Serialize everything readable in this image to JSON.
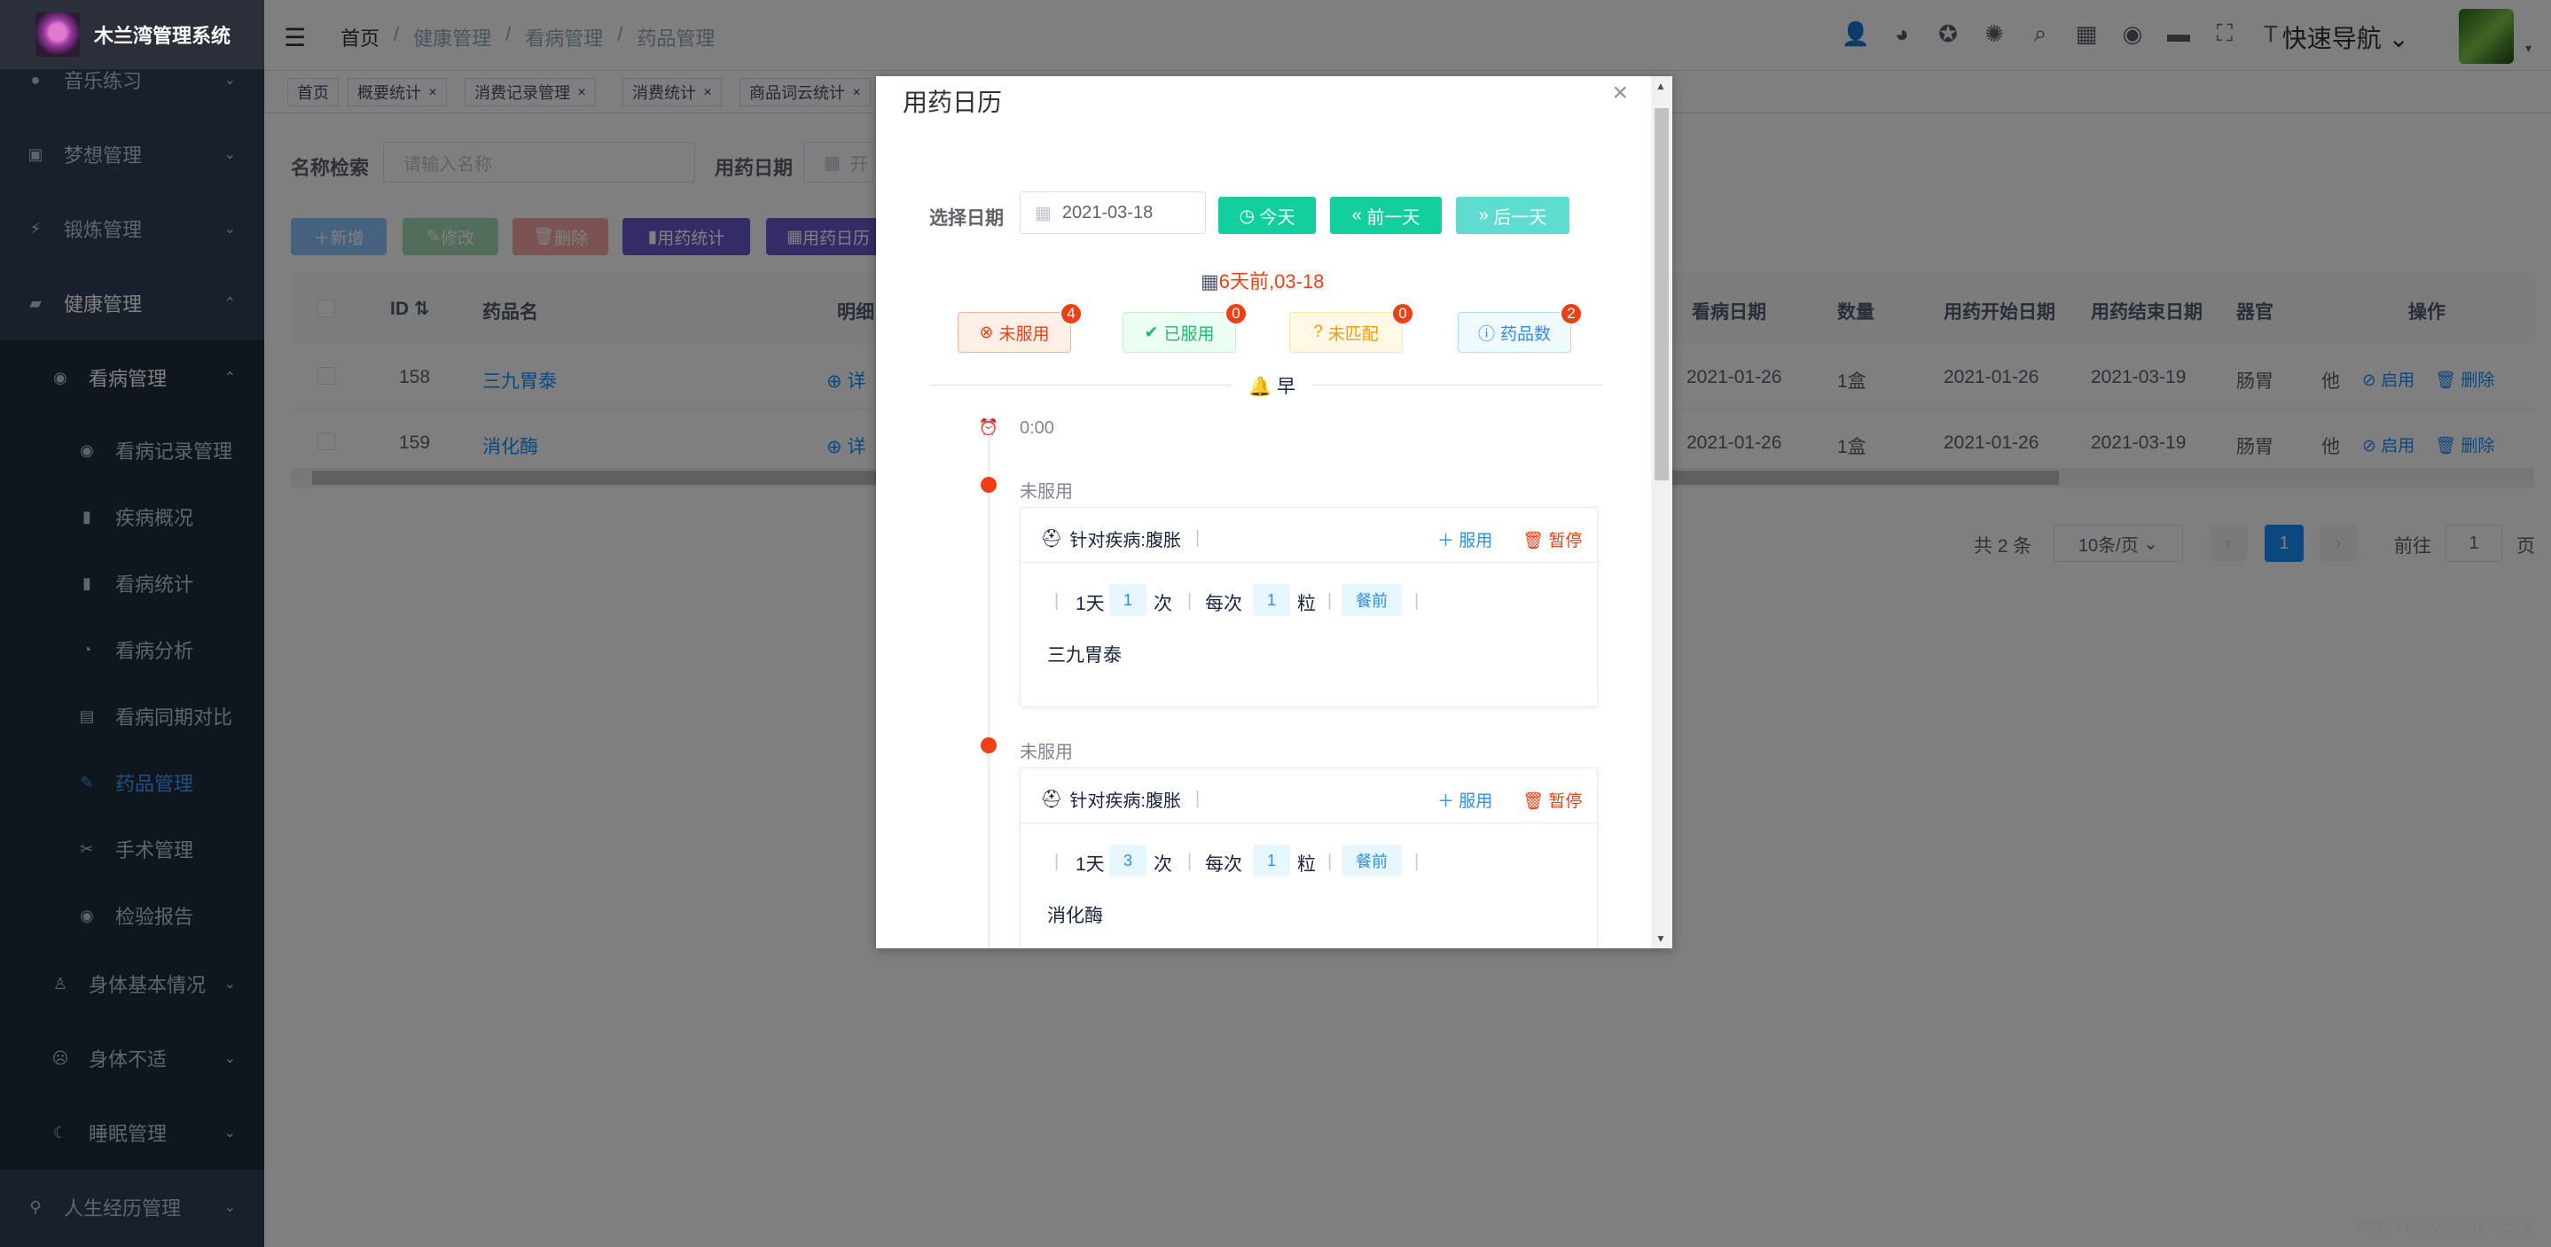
{
  "app": {
    "title": "木兰湾管理系统"
  },
  "sidebar": {
    "items": [
      {
        "label": "音乐练习",
        "icon": "music-icon"
      },
      {
        "label": "梦想管理",
        "icon": "dream-icon"
      },
      {
        "label": "锻炼管理",
        "icon": "exercise-icon"
      },
      {
        "label": "健康管理",
        "icon": "health-icon"
      },
      {
        "label": "看病管理",
        "icon": "hospital-icon"
      },
      {
        "label": "看病记录管理",
        "icon": "record-icon"
      },
      {
        "label": "疾病概况",
        "icon": "bar-chart-icon"
      },
      {
        "label": "看病统计",
        "icon": "bar-chart-icon"
      },
      {
        "label": "看病分析",
        "icon": "pie-chart-icon"
      },
      {
        "label": "看病同期对比",
        "icon": "compare-icon"
      },
      {
        "label": "药品管理",
        "icon": "medicine-icon"
      },
      {
        "label": "手术管理",
        "icon": "surgery-icon"
      },
      {
        "label": "检验报告",
        "icon": "report-icon"
      },
      {
        "label": "身体基本情况",
        "icon": "body-icon"
      },
      {
        "label": "身体不适",
        "icon": "discomfort-icon"
      },
      {
        "label": "睡眠管理",
        "icon": "moon-icon"
      },
      {
        "label": "人生经历管理",
        "icon": "life-icon"
      }
    ]
  },
  "header": {
    "breadcrumb": [
      "首页",
      "健康管理",
      "看病管理",
      "药品管理"
    ],
    "quick_nav": "快速导航"
  },
  "tags": [
    {
      "label": "首页"
    },
    {
      "label": "概要统计"
    },
    {
      "label": "消费记录管理"
    },
    {
      "label": "消费统计"
    },
    {
      "label": "商品词云统计"
    }
  ],
  "search": {
    "name_label": "名称检索",
    "name_placeholder": "请输入名称",
    "date_label": "用药日期",
    "date_placeholder": "开"
  },
  "toolbar": {
    "add": "新增",
    "edit": "修改",
    "delete": "删除",
    "stats": "用药统计",
    "calendar": "用药日历"
  },
  "table": {
    "headers": {
      "id": "ID",
      "name": "药品名",
      "detail": "明细",
      "disease_date": "看病日期",
      "qty": "数量",
      "start": "用药开始日期",
      "end": "用药结束日期",
      "organ": "器官",
      "ops": "操作"
    },
    "rows": [
      {
        "id": "158",
        "name": "三九胃泰",
        "detail": "详",
        "disease_date": "2021-01-26",
        "qty": "1盒",
        "start": "2021-01-26",
        "end": "2021-03-19",
        "organ": "肠胃",
        "extra": "他",
        "enable": "启用",
        "del": "删除"
      },
      {
        "id": "159",
        "name": "消化酶",
        "detail": "详",
        "disease_date": "2021-01-26",
        "qty": "1盒",
        "start": "2021-01-26",
        "end": "2021-03-19",
        "organ": "肠胃",
        "extra": "他",
        "enable": "启用",
        "del": "删除"
      }
    ]
  },
  "pagination": {
    "total": "共 2 条",
    "page_size": "10条/页",
    "current": "1",
    "goto_label": "前往",
    "goto_value": "1",
    "page_suffix": "页"
  },
  "dialog": {
    "title": "用药日历",
    "date_label": "选择日期",
    "date_value": "2021-03-18",
    "today": "今天",
    "prev": "前一天",
    "next": "后一天",
    "relative_date": "6天前,03-18",
    "stats": [
      {
        "label": "未服用",
        "count": "4"
      },
      {
        "label": "已服用",
        "count": "0"
      },
      {
        "label": "未匹配",
        "count": "0"
      },
      {
        "label": "药品数",
        "count": "2"
      }
    ],
    "period": "早",
    "time": "0:00",
    "entries": [
      {
        "status": "未服用",
        "title": "针对疾病:腹胀",
        "take": "服用",
        "pause": "暂停",
        "per_day": "1天",
        "times": "1",
        "times_unit": "次",
        "each": "每次",
        "amount": "1",
        "amount_unit": "粒",
        "timing": "餐前",
        "drug": "三九胃泰"
      },
      {
        "status": "未服用",
        "title": "针对疾病:腹胀",
        "take": "服用",
        "pause": "暂停",
        "per_day": "1天",
        "times": "3",
        "times_unit": "次",
        "each": "每次",
        "amount": "1",
        "amount_unit": "粒",
        "timing": "餐前",
        "drug": "消化酶"
      }
    ]
  },
  "watermark": "CSDN @Python代码大全",
  "colors": {
    "sidebar_bg": "#304156",
    "primary": "#1890ff",
    "teal": "#13ce9f",
    "danger": "#ed4014"
  }
}
